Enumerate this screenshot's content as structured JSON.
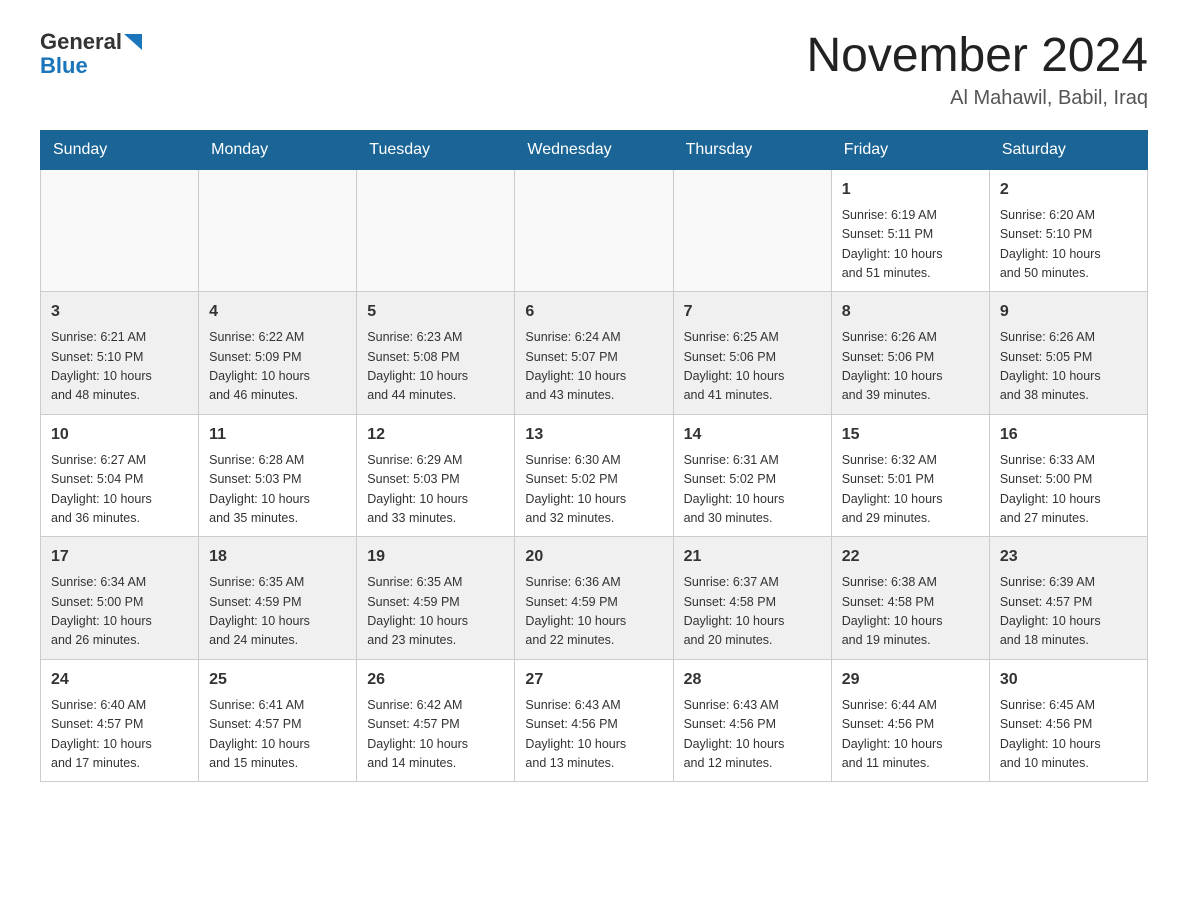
{
  "header": {
    "logo": {
      "general": "General",
      "blue_icon": "▶",
      "blue": "Blue"
    },
    "title": "November 2024",
    "location": "Al Mahawil, Babil, Iraq"
  },
  "days_of_week": [
    "Sunday",
    "Monday",
    "Tuesday",
    "Wednesday",
    "Thursday",
    "Friday",
    "Saturday"
  ],
  "weeks": [
    {
      "days": [
        {
          "number": "",
          "info": ""
        },
        {
          "number": "",
          "info": ""
        },
        {
          "number": "",
          "info": ""
        },
        {
          "number": "",
          "info": ""
        },
        {
          "number": "",
          "info": ""
        },
        {
          "number": "1",
          "info": "Sunrise: 6:19 AM\nSunset: 5:11 PM\nDaylight: 10 hours\nand 51 minutes."
        },
        {
          "number": "2",
          "info": "Sunrise: 6:20 AM\nSunset: 5:10 PM\nDaylight: 10 hours\nand 50 minutes."
        }
      ]
    },
    {
      "days": [
        {
          "number": "3",
          "info": "Sunrise: 6:21 AM\nSunset: 5:10 PM\nDaylight: 10 hours\nand 48 minutes."
        },
        {
          "number": "4",
          "info": "Sunrise: 6:22 AM\nSunset: 5:09 PM\nDaylight: 10 hours\nand 46 minutes."
        },
        {
          "number": "5",
          "info": "Sunrise: 6:23 AM\nSunset: 5:08 PM\nDaylight: 10 hours\nand 44 minutes."
        },
        {
          "number": "6",
          "info": "Sunrise: 6:24 AM\nSunset: 5:07 PM\nDaylight: 10 hours\nand 43 minutes."
        },
        {
          "number": "7",
          "info": "Sunrise: 6:25 AM\nSunset: 5:06 PM\nDaylight: 10 hours\nand 41 minutes."
        },
        {
          "number": "8",
          "info": "Sunrise: 6:26 AM\nSunset: 5:06 PM\nDaylight: 10 hours\nand 39 minutes."
        },
        {
          "number": "9",
          "info": "Sunrise: 6:26 AM\nSunset: 5:05 PM\nDaylight: 10 hours\nand 38 minutes."
        }
      ]
    },
    {
      "days": [
        {
          "number": "10",
          "info": "Sunrise: 6:27 AM\nSunset: 5:04 PM\nDaylight: 10 hours\nand 36 minutes."
        },
        {
          "number": "11",
          "info": "Sunrise: 6:28 AM\nSunset: 5:03 PM\nDaylight: 10 hours\nand 35 minutes."
        },
        {
          "number": "12",
          "info": "Sunrise: 6:29 AM\nSunset: 5:03 PM\nDaylight: 10 hours\nand 33 minutes."
        },
        {
          "number": "13",
          "info": "Sunrise: 6:30 AM\nSunset: 5:02 PM\nDaylight: 10 hours\nand 32 minutes."
        },
        {
          "number": "14",
          "info": "Sunrise: 6:31 AM\nSunset: 5:02 PM\nDaylight: 10 hours\nand 30 minutes."
        },
        {
          "number": "15",
          "info": "Sunrise: 6:32 AM\nSunset: 5:01 PM\nDaylight: 10 hours\nand 29 minutes."
        },
        {
          "number": "16",
          "info": "Sunrise: 6:33 AM\nSunset: 5:00 PM\nDaylight: 10 hours\nand 27 minutes."
        }
      ]
    },
    {
      "days": [
        {
          "number": "17",
          "info": "Sunrise: 6:34 AM\nSunset: 5:00 PM\nDaylight: 10 hours\nand 26 minutes."
        },
        {
          "number": "18",
          "info": "Sunrise: 6:35 AM\nSunset: 4:59 PM\nDaylight: 10 hours\nand 24 minutes."
        },
        {
          "number": "19",
          "info": "Sunrise: 6:35 AM\nSunset: 4:59 PM\nDaylight: 10 hours\nand 23 minutes."
        },
        {
          "number": "20",
          "info": "Sunrise: 6:36 AM\nSunset: 4:59 PM\nDaylight: 10 hours\nand 22 minutes."
        },
        {
          "number": "21",
          "info": "Sunrise: 6:37 AM\nSunset: 4:58 PM\nDaylight: 10 hours\nand 20 minutes."
        },
        {
          "number": "22",
          "info": "Sunrise: 6:38 AM\nSunset: 4:58 PM\nDaylight: 10 hours\nand 19 minutes."
        },
        {
          "number": "23",
          "info": "Sunrise: 6:39 AM\nSunset: 4:57 PM\nDaylight: 10 hours\nand 18 minutes."
        }
      ]
    },
    {
      "days": [
        {
          "number": "24",
          "info": "Sunrise: 6:40 AM\nSunset: 4:57 PM\nDaylight: 10 hours\nand 17 minutes."
        },
        {
          "number": "25",
          "info": "Sunrise: 6:41 AM\nSunset: 4:57 PM\nDaylight: 10 hours\nand 15 minutes."
        },
        {
          "number": "26",
          "info": "Sunrise: 6:42 AM\nSunset: 4:57 PM\nDaylight: 10 hours\nand 14 minutes."
        },
        {
          "number": "27",
          "info": "Sunrise: 6:43 AM\nSunset: 4:56 PM\nDaylight: 10 hours\nand 13 minutes."
        },
        {
          "number": "28",
          "info": "Sunrise: 6:43 AM\nSunset: 4:56 PM\nDaylight: 10 hours\nand 12 minutes."
        },
        {
          "number": "29",
          "info": "Sunrise: 6:44 AM\nSunset: 4:56 PM\nDaylight: 10 hours\nand 11 minutes."
        },
        {
          "number": "30",
          "info": "Sunrise: 6:45 AM\nSunset: 4:56 PM\nDaylight: 10 hours\nand 10 minutes."
        }
      ]
    }
  ]
}
